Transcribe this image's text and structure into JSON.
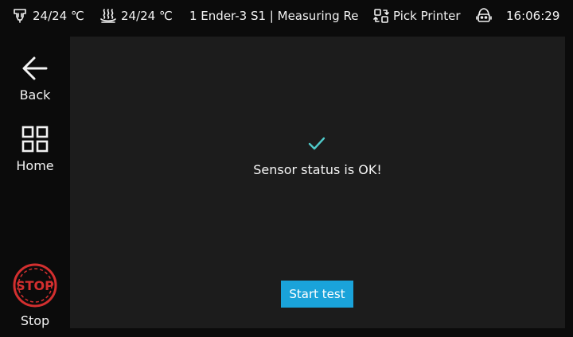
{
  "status_bar": {
    "nozzle_temp": "24/24 ℃",
    "bed_temp": "24/24 ℃",
    "printer_name": "1 Ender-3 S1 | Measuring Re",
    "pick_printer_label": "Pick Printer",
    "time": "16:06:29"
  },
  "nav": {
    "back_label": "Back",
    "home_label": "Home",
    "stop_label": "Stop",
    "stop_badge": "STOP"
  },
  "main": {
    "status_message": "Sensor status is OK!",
    "start_button_label": "Start test"
  },
  "colors": {
    "accent": "#1aa3da",
    "check": "#4fc9c9",
    "stop_red": "#d32f2f",
    "panel_bg": "#1c1c1c",
    "background": "#0b0b0b"
  },
  "icons": {
    "nozzle": "nozzle-icon",
    "bed": "heated-bed-icon",
    "pick_printer": "switch-printer-icon",
    "robot": "robot-icon",
    "back": "arrow-left-icon",
    "home": "grid-icon",
    "stop": "stop-sign-icon",
    "check": "check-icon"
  }
}
